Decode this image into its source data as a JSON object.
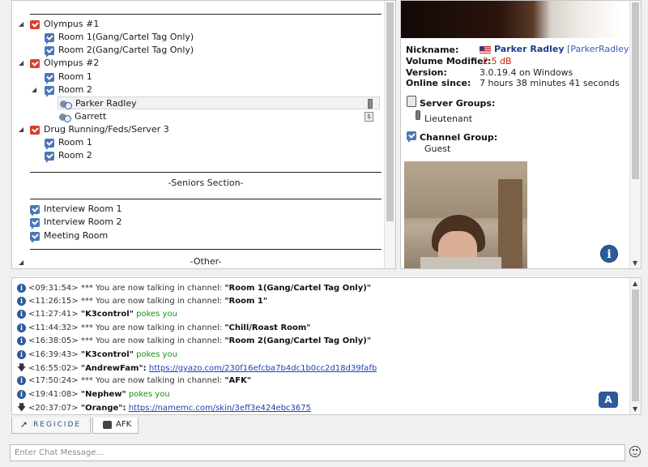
{
  "tree": {
    "top_separator": "",
    "servers": [
      {
        "name": "Olympus #1",
        "channels": [
          "Room 1(Gang/Cartel Tag Only)",
          "Room 2(Gang/Cartel Tag Only)"
        ]
      },
      {
        "name": "Olympus #2",
        "channels": [
          "Room 1",
          "Room 2"
        ],
        "users": [
          "Parker Radley",
          "Garrett"
        ]
      },
      {
        "name": "Drug Running/Feds/Server 3",
        "channels": [
          "Room 1",
          "Room 2"
        ]
      }
    ],
    "seniors_separator": "-Seniors Section-",
    "seniors_channels": [
      "Interview Room 1",
      "Interview Room 2",
      "Meeting Room"
    ],
    "other_separator": "-Other-"
  },
  "info": {
    "nickname_label": "Nickname:",
    "nickname": "Parker Radley",
    "uid": "[ParkerRadley]",
    "volume_label": "Volume Modifier:",
    "volume": "-2.5 dB",
    "version_label": "Version:",
    "version": "3.0.19.4 on Windows",
    "online_label": "Online since:",
    "online": "7 hours 38 minutes 41 seconds",
    "server_groups_label": "Server Groups:",
    "server_group": "Lieutenant",
    "channel_group_label": "Channel Group:",
    "channel_group": "Guest"
  },
  "chat": {
    "lines": [
      {
        "time": "<09:31:54>",
        "text": "*** You are now talking in channel:",
        "channel": "\"Room 1(Gang/Cartel Tag Only)\""
      },
      {
        "time": "<11:26:15>",
        "text": "*** You are now talking in channel:",
        "channel": "\"Room 1\""
      },
      {
        "time": "<11:27:41>",
        "name": "\"K3control\"",
        "action": "pokes you"
      },
      {
        "time": "<11:44:32>",
        "text": "*** You are now talking in channel:",
        "channel": "\"Chill/Roast Room\""
      },
      {
        "time": "<16:38:05>",
        "text": "*** You are now talking in channel:",
        "channel": "\"Room 2(Gang/Cartel Tag Only)\""
      },
      {
        "time": "<16:39:43>",
        "name": "\"K3control\"",
        "action": "pokes you"
      },
      {
        "time": "<16:55:02>",
        "name": "\"AndrewFam\":",
        "url": "https://gyazo.com/230f16efcba7b4dc1b0cc2d18d39fafb"
      },
      {
        "time": "<17:50:24>",
        "text": "*** You are now talking in channel:",
        "channel": "\"AFK\""
      },
      {
        "time": "<19:41:08>",
        "name": "\"Nephew\"",
        "action": "pokes you"
      },
      {
        "time": "<20:37:07>",
        "name": "\"Orange\":",
        "url": "https://namemc.com/skin/3eff3e424ebc3675"
      }
    ],
    "bubble": "A"
  },
  "tabs": [
    {
      "label": "REGICIDE"
    },
    {
      "label": "AFK"
    }
  ],
  "input": {
    "placeholder": "Enter Chat Message..."
  },
  "colors": {
    "link": "#1f3fb4",
    "poke": "#179316",
    "volume": "#d21d12",
    "nickname": "#1b3f8a"
  }
}
